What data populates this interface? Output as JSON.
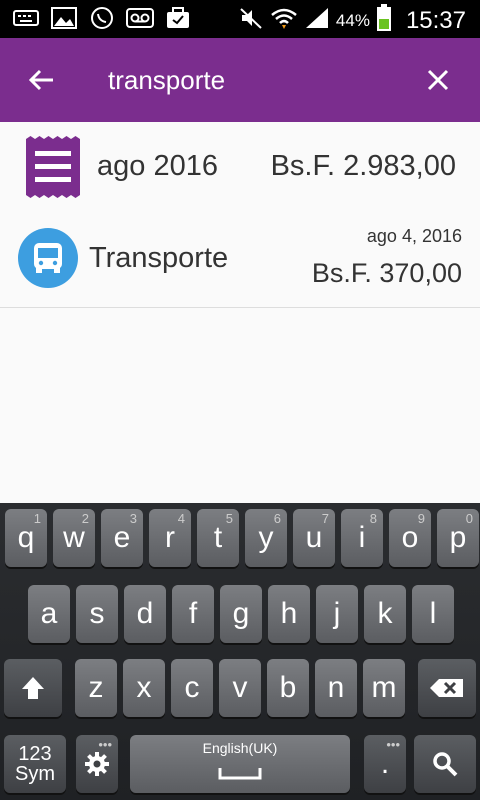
{
  "status_bar": {
    "battery_percent": "44%",
    "time": "15:37",
    "icons": [
      "keyboard-icon",
      "image-icon",
      "whatsapp-icon",
      "voicemail-icon",
      "briefcase-icon",
      "mute-icon",
      "wifi-icon",
      "signal-icon",
      "battery-icon"
    ]
  },
  "app_bar": {
    "query": "transporte",
    "back_icon": "arrow-back-icon",
    "clear_icon": "close-icon",
    "color": "#7b2d8e"
  },
  "results": {
    "month": {
      "label": "ago 2016",
      "total": "Bs.F. 2.983,00",
      "icon": "receipt-icon"
    },
    "transaction": {
      "category": "Transporte",
      "date": "ago 4, 2016",
      "amount": "Bs.F. 370,00",
      "icon": "bus-icon",
      "icon_color": "#3d9ee0"
    }
  },
  "keyboard": {
    "row1": [
      {
        "k": "q",
        "h": "1"
      },
      {
        "k": "w",
        "h": "2"
      },
      {
        "k": "e",
        "h": "3"
      },
      {
        "k": "r",
        "h": "4"
      },
      {
        "k": "t",
        "h": "5"
      },
      {
        "k": "y",
        "h": "6"
      },
      {
        "k": "u",
        "h": "7"
      },
      {
        "k": "i",
        "h": "8"
      },
      {
        "k": "o",
        "h": "9"
      },
      {
        "k": "p",
        "h": "0"
      }
    ],
    "row2": [
      "a",
      "s",
      "d",
      "f",
      "g",
      "h",
      "j",
      "k",
      "l"
    ],
    "row3": [
      "z",
      "x",
      "c",
      "v",
      "b",
      "n",
      "m"
    ],
    "sym_top": "123",
    "sym_bottom": "Sym",
    "space_label": "English(UK)",
    "period": "."
  }
}
